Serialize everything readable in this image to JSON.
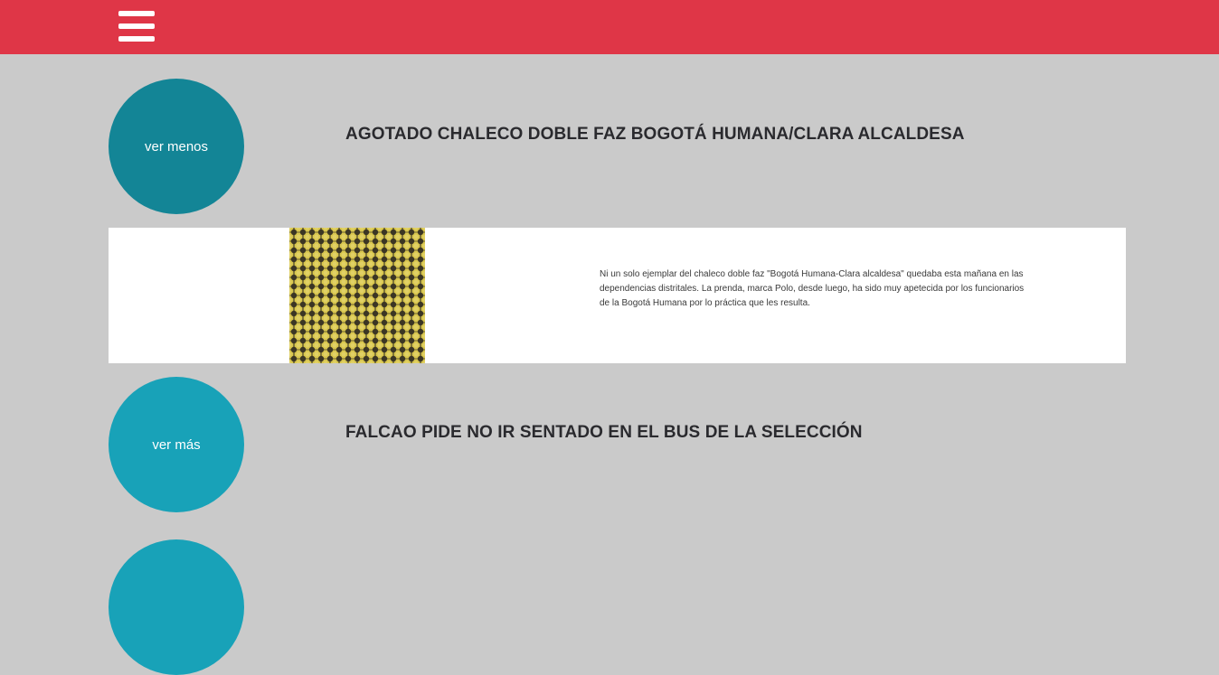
{
  "header": {
    "menu_icon": "hamburger-menu-icon",
    "background_color": "#df3647"
  },
  "articles": [
    {
      "toggle_label": "ver menos",
      "toggle_color": "#138596",
      "title": "AGOTADO CHALECO DOBLE FAZ BOGOTÁ HUMANA/CLARA ALCALDESA",
      "expanded": true,
      "summary": "Ni un solo ejemplar del chaleco doble faz \"Bogotá Humana-Clara alcaldesa\" quedaba esta mañana en las dependencias distritales. La prenda, marca Polo, desde luego, ha sido muy apetecida por los funcionarios de la Bogotá Humana por lo práctica que les resulta."
    },
    {
      "toggle_label": "ver más",
      "toggle_color": "#18a2b8",
      "title": "FALCAO PIDE NO IR SENTADO EN EL BUS DE LA SELECCIÓN",
      "expanded": false
    },
    {
      "toggle_label": "",
      "toggle_color": "#18a2b8",
      "title": "",
      "expanded": false
    }
  ],
  "colors": {
    "page_background": "#cacaca",
    "panel_background": "#ffffff",
    "title_text": "#2a2a2e",
    "thumbnail_pattern_dark": "#3b3524",
    "thumbnail_pattern_light": "#d8c64e"
  }
}
